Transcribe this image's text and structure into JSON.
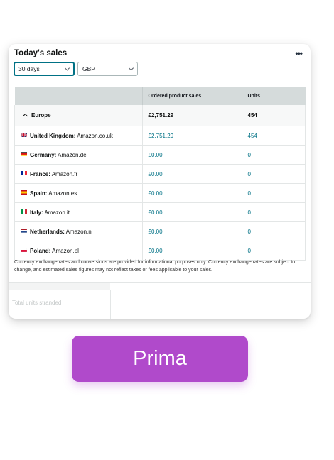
{
  "card": {
    "title": "Today's sales",
    "more_icon": "•••",
    "period_select": "30 days",
    "currency_select": "GBP"
  },
  "table": {
    "headers": [
      "",
      "Ordered product sales",
      "Units"
    ],
    "group": {
      "name": "Europe",
      "sales": "£2,751.29",
      "units": "454"
    },
    "rows": [
      {
        "flag": "uk-flag-icon",
        "country": "United Kingdom:",
        "store": "Amazon.co.uk",
        "sales": "£2,751.29",
        "units": "454"
      },
      {
        "flag": "germany-flag-icon",
        "country": "Germany:",
        "store": "Amazon.de",
        "sales": "£0.00",
        "units": "0"
      },
      {
        "flag": "france-flag-icon",
        "country": "France:",
        "store": "Amazon.fr",
        "sales": "£0.00",
        "units": "0"
      },
      {
        "flag": "spain-flag-icon",
        "country": "Spain:",
        "store": "Amazon.es",
        "sales": "£0.00",
        "units": "0"
      },
      {
        "flag": "italy-flag-icon",
        "country": "Italy:",
        "store": "Amazon.it",
        "sales": "£0.00",
        "units": "0"
      },
      {
        "flag": "netherlands-flag-icon",
        "country": "Netherlands:",
        "store": "Amazon.nl",
        "sales": "£0.00",
        "units": "0"
      },
      {
        "flag": "poland-flag-icon",
        "country": "Poland:",
        "store": "Amazon.pl",
        "sales": "£0.00",
        "units": "0"
      }
    ]
  },
  "disclaimer": "Currency exchange rates and conversions are provided for informational purposes only. Currency exchange rates are subject to change, and estimated sales figures may not reflect taxes or fees applicable to your sales.",
  "stranded_label": "Total units stranded",
  "prima_button": "Prima",
  "colors": {
    "link": "#007185",
    "header_bg": "#d5dbdb",
    "button": "#b04acb"
  }
}
